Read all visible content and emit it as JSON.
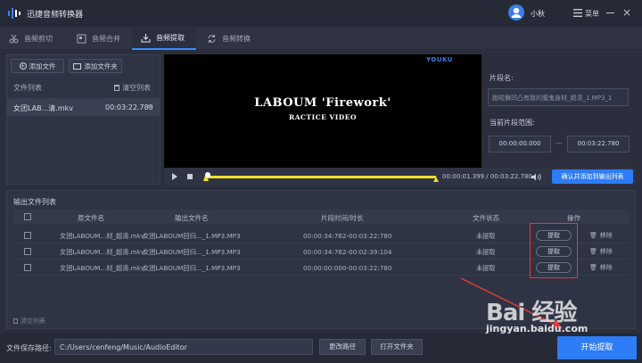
{
  "app": {
    "title": "迅捷音频转换器",
    "user": "小秋",
    "menu_label": "菜单"
  },
  "tabs": [
    {
      "label": "音频剪切",
      "icon": "scissors-icon"
    },
    {
      "label": "音频合并",
      "icon": "merge-icon"
    },
    {
      "label": "音频提取",
      "icon": "extract-icon"
    },
    {
      "label": "音频转换",
      "icon": "convert-icon"
    }
  ],
  "active_tab": "音频提取",
  "left_panel": {
    "add_file": "添加文件",
    "add_folder": "添加文件夹",
    "file_list_title": "文件列表",
    "clear_list": "清空列表",
    "files": [
      {
        "name": "女团LAB...清.mkv",
        "duration": "00:03:22.780"
      }
    ]
  },
  "video": {
    "watermark": "YOUKU",
    "title_line": "LABOUM 'Firework'",
    "subtitle_line": "RACTICE VIDEO"
  },
  "segment": {
    "name_label": "片段名:",
    "name_value": "1_跑啦舞凹凸有致的魔鬼身材_超清_1.MP3",
    "range_label": "当前片段范围:",
    "start": "00:00:00.000",
    "end": "00:03:22.780",
    "sep": "—"
  },
  "player": {
    "current_time": "00:00:01.399",
    "total_time": "00:03:22.780",
    "time_sep": "/",
    "add_output_button": "确认并添加到输出列表"
  },
  "output": {
    "title": "输出文件列表",
    "headers": [
      "原文件名",
      "输出文件名",
      "片段时间/时长",
      "文件状态",
      "操作"
    ],
    "rows": [
      {
        "src": "女团LABOUM...材_超清.mkv",
        "out": "女团LABOUM回归..._1.MP3.MP3",
        "time": "00:00:34:762-00:03:22:780",
        "status": "未提取",
        "action": "提取",
        "remove": "移除"
      },
      {
        "src": "女团LABOUM...材_超清.mkv",
        "out": "女团LABOUM回归..._1.MP3.MP3",
        "time": "00:00:34:762-00:02:39:104",
        "status": "未提取",
        "action": "提取",
        "remove": "移除"
      },
      {
        "src": "女团LABOUM...材_超清.mkv",
        "out": "女团LABOUM回归..._1.MP3.MP3",
        "time": "00:00:00:000-00:03:22:780",
        "status": "未提取",
        "action": "提取",
        "remove": "移除"
      }
    ],
    "clear_list": "清空列表"
  },
  "footer": {
    "save_label": "文件保存路径:",
    "save_path": "C:/Users/cenfeng/Music/AudioEditor",
    "change_path": "更改路径",
    "open_folder": "打开文件夹",
    "start_button": "开始提取"
  },
  "watermark": {
    "logo": "Bai 经验",
    "url": "jingyan.baidu.com"
  },
  "colors": {
    "accent": "#2e7cf6",
    "highlight": "#e23b3b",
    "trim": "#f2dd2b"
  }
}
